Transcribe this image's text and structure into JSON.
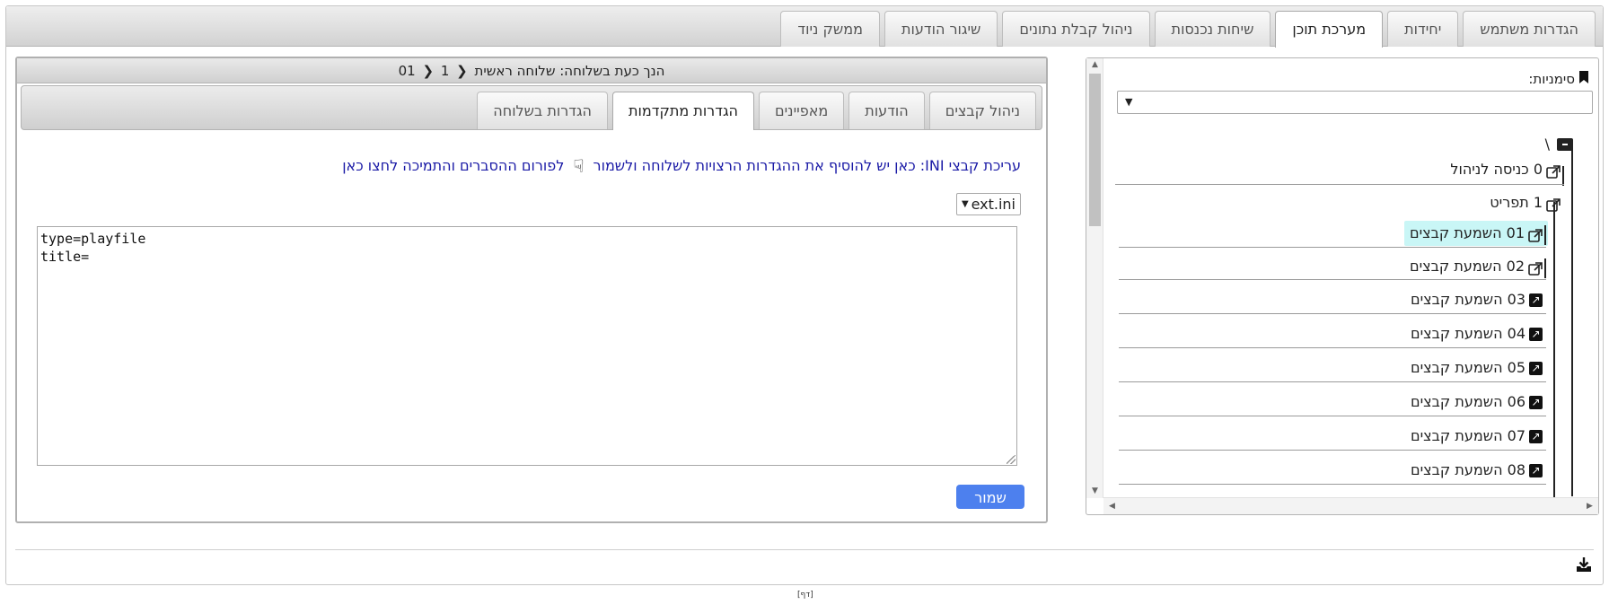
{
  "main_tabs": [
    {
      "label": "הגדרות משתמש",
      "active": false
    },
    {
      "label": "יחידות",
      "active": false
    },
    {
      "label": "מערכת תוכן",
      "active": true
    },
    {
      "label": "שיחות נכנסות",
      "active": false
    },
    {
      "label": "ניהול קבלת נתונים",
      "active": false
    },
    {
      "label": "שיגור הודעות",
      "active": false
    },
    {
      "label": "ממשק ניוד",
      "active": false
    }
  ],
  "tree": {
    "bookmarks_label": "סימניות:",
    "bookmarks_value": "",
    "root_label": "\\",
    "items": [
      {
        "label": "0 כניסה לניהול",
        "icon": "external-link-icon"
      },
      {
        "label": "1 תפריט",
        "icon": "external-link-icon"
      },
      {
        "label": "01 השמעת קבצים",
        "icon": "external-link-icon",
        "selected": true
      },
      {
        "label": "02 השמעת קבצים",
        "icon": "external-link-icon"
      },
      {
        "label": "03 השמעת קבצים",
        "icon": "external-link-square-icon"
      },
      {
        "label": "04 השמעת קבצים",
        "icon": "external-link-square-icon"
      },
      {
        "label": "05 השמעת קבצים",
        "icon": "external-link-square-icon"
      },
      {
        "label": "06 השמעת קבצים",
        "icon": "external-link-square-icon"
      },
      {
        "label": "07 השמעת קבצים",
        "icon": "external-link-square-icon"
      },
      {
        "label": "08 השמעת קבצים",
        "icon": "external-link-square-icon"
      }
    ]
  },
  "editor": {
    "header_prefix": "הנך כעת בשלוחה:",
    "breadcrumb": [
      "שלוחה ראשית",
      "1",
      "01"
    ],
    "tabs": [
      {
        "label": "ניהול קבצים",
        "active": false
      },
      {
        "label": "הודעות",
        "active": false
      },
      {
        "label": "מאפיינים",
        "active": false
      },
      {
        "label": "הגדרות מתקדמות",
        "active": true
      },
      {
        "label": "הגדרות בשלוחה",
        "active": false
      }
    ],
    "ini_info_text": "עריכת קבצי INI: כאן יש להוסיף את ההגדרות הרצויות לשלוחה ולשמור",
    "forum_link_text": "לפורום ההסברים והתמיכה לחצו כאן",
    "file_select_value": "ext.ini",
    "ini_content": "type=playfile\ntitle=",
    "save_label": "שמור"
  },
  "footer": {
    "bottom_mark": "[דף]"
  },
  "colors": {
    "accent_button": "#4d80ee",
    "selected_row": "#c9f6f6",
    "link_text": "#1a1aa6"
  }
}
